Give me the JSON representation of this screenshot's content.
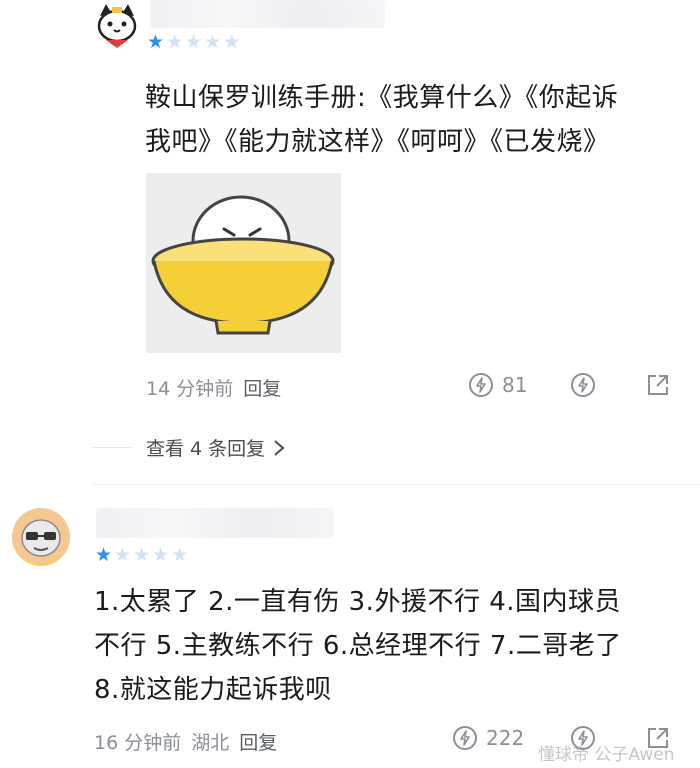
{
  "comments": [
    {
      "author_name": "",
      "rating": 1,
      "rating_max": 5,
      "text_lines": [
        "鞍山保罗训练手册:《我算什么》《你起诉",
        "我吧》《能力就这样》《呵呵》《已发烧》"
      ],
      "time": "14 分钟前",
      "reply_label": "回复",
      "like_count": "81",
      "view_replies": "查看 4 条回复"
    },
    {
      "author_name": "",
      "rating": 1,
      "rating_max": 5,
      "text_lines": [
        "1.太累了 2.一直有伤 3.外援不行 4.国内球员",
        "不行 5.主教练不行 6.总经理不行 7.二哥老了",
        "8.就这能力起诉我呗"
      ],
      "time": "16 分钟前",
      "location": "湖北",
      "reply_label": "回复",
      "like_count": "222"
    }
  ],
  "watermark": "懂球帝 公子Awen",
  "colors": {
    "star_on": "#2f8fe6",
    "star_off": "#cfe2f6",
    "meta": "#8b8f96"
  },
  "icons": [
    "cat-avatar-icon",
    "bald-man-avatar-icon",
    "like-lightning-icon",
    "dislike-icon",
    "share-icon",
    "chevron-right-icon"
  ]
}
